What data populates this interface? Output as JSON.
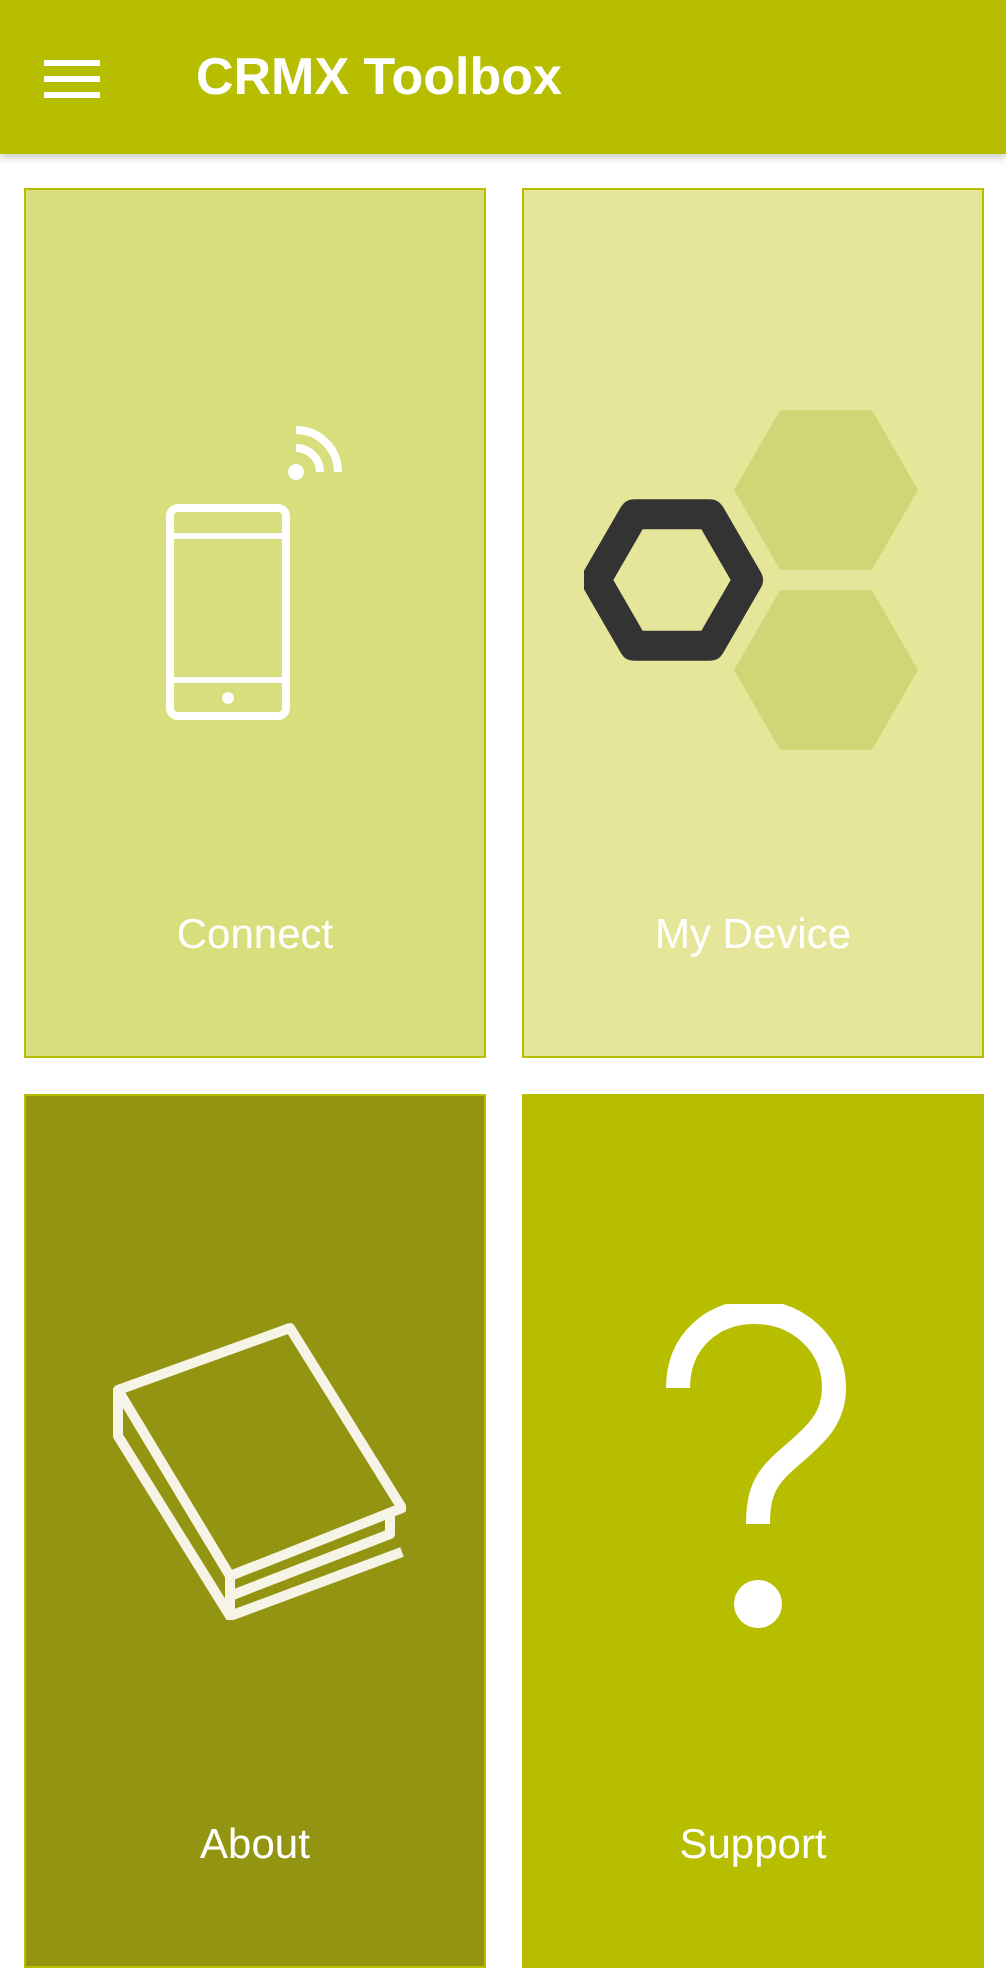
{
  "app_bar": {
    "title": "CRMX Toolbox"
  },
  "tiles": [
    {
      "label": "Connect",
      "kind": "phone",
      "color": "#d9de7c"
    },
    {
      "label": "My Device",
      "kind": "hexagons",
      "color": "#e6e69a"
    },
    {
      "label": "About",
      "kind": "book",
      "color": "#949413"
    },
    {
      "label": "Support",
      "kind": "question",
      "color": "#b7be00"
    }
  ]
}
